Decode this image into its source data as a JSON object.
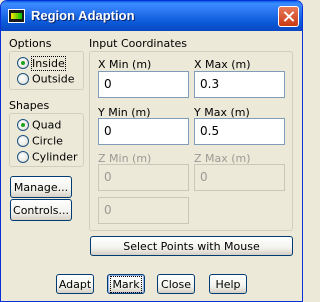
{
  "window": {
    "title": "Region Adaption"
  },
  "options": {
    "label": "Options",
    "items": [
      {
        "label": "Inside",
        "checked": true
      },
      {
        "label": "Outside",
        "checked": false
      }
    ]
  },
  "shapes": {
    "label": "Shapes",
    "items": [
      {
        "label": "Quad",
        "checked": true
      },
      {
        "label": "Circle",
        "checked": false
      },
      {
        "label": "Cylinder",
        "checked": false
      }
    ]
  },
  "left_buttons": {
    "manage": "Manage...",
    "controls": "Controls..."
  },
  "coords": {
    "label": "Input Coordinates",
    "x_min": {
      "label": "X Min (m)",
      "value": "0"
    },
    "x_max": {
      "label": "X Max (m)",
      "value": "0.3"
    },
    "y_min": {
      "label": "Y Min (m)",
      "value": "0"
    },
    "y_max": {
      "label": "Y Max (m)",
      "value": "0.5"
    },
    "z_min": {
      "label": "Z Min (m)",
      "value": "0"
    },
    "z_max": {
      "label": "Z Max (m)",
      "value": "0"
    },
    "radius": {
      "value": "0"
    }
  },
  "select_button": "Select Points with Mouse",
  "bottom_buttons": {
    "adapt": "Adapt",
    "mark": "Mark",
    "close": "Close",
    "help": "Help"
  }
}
